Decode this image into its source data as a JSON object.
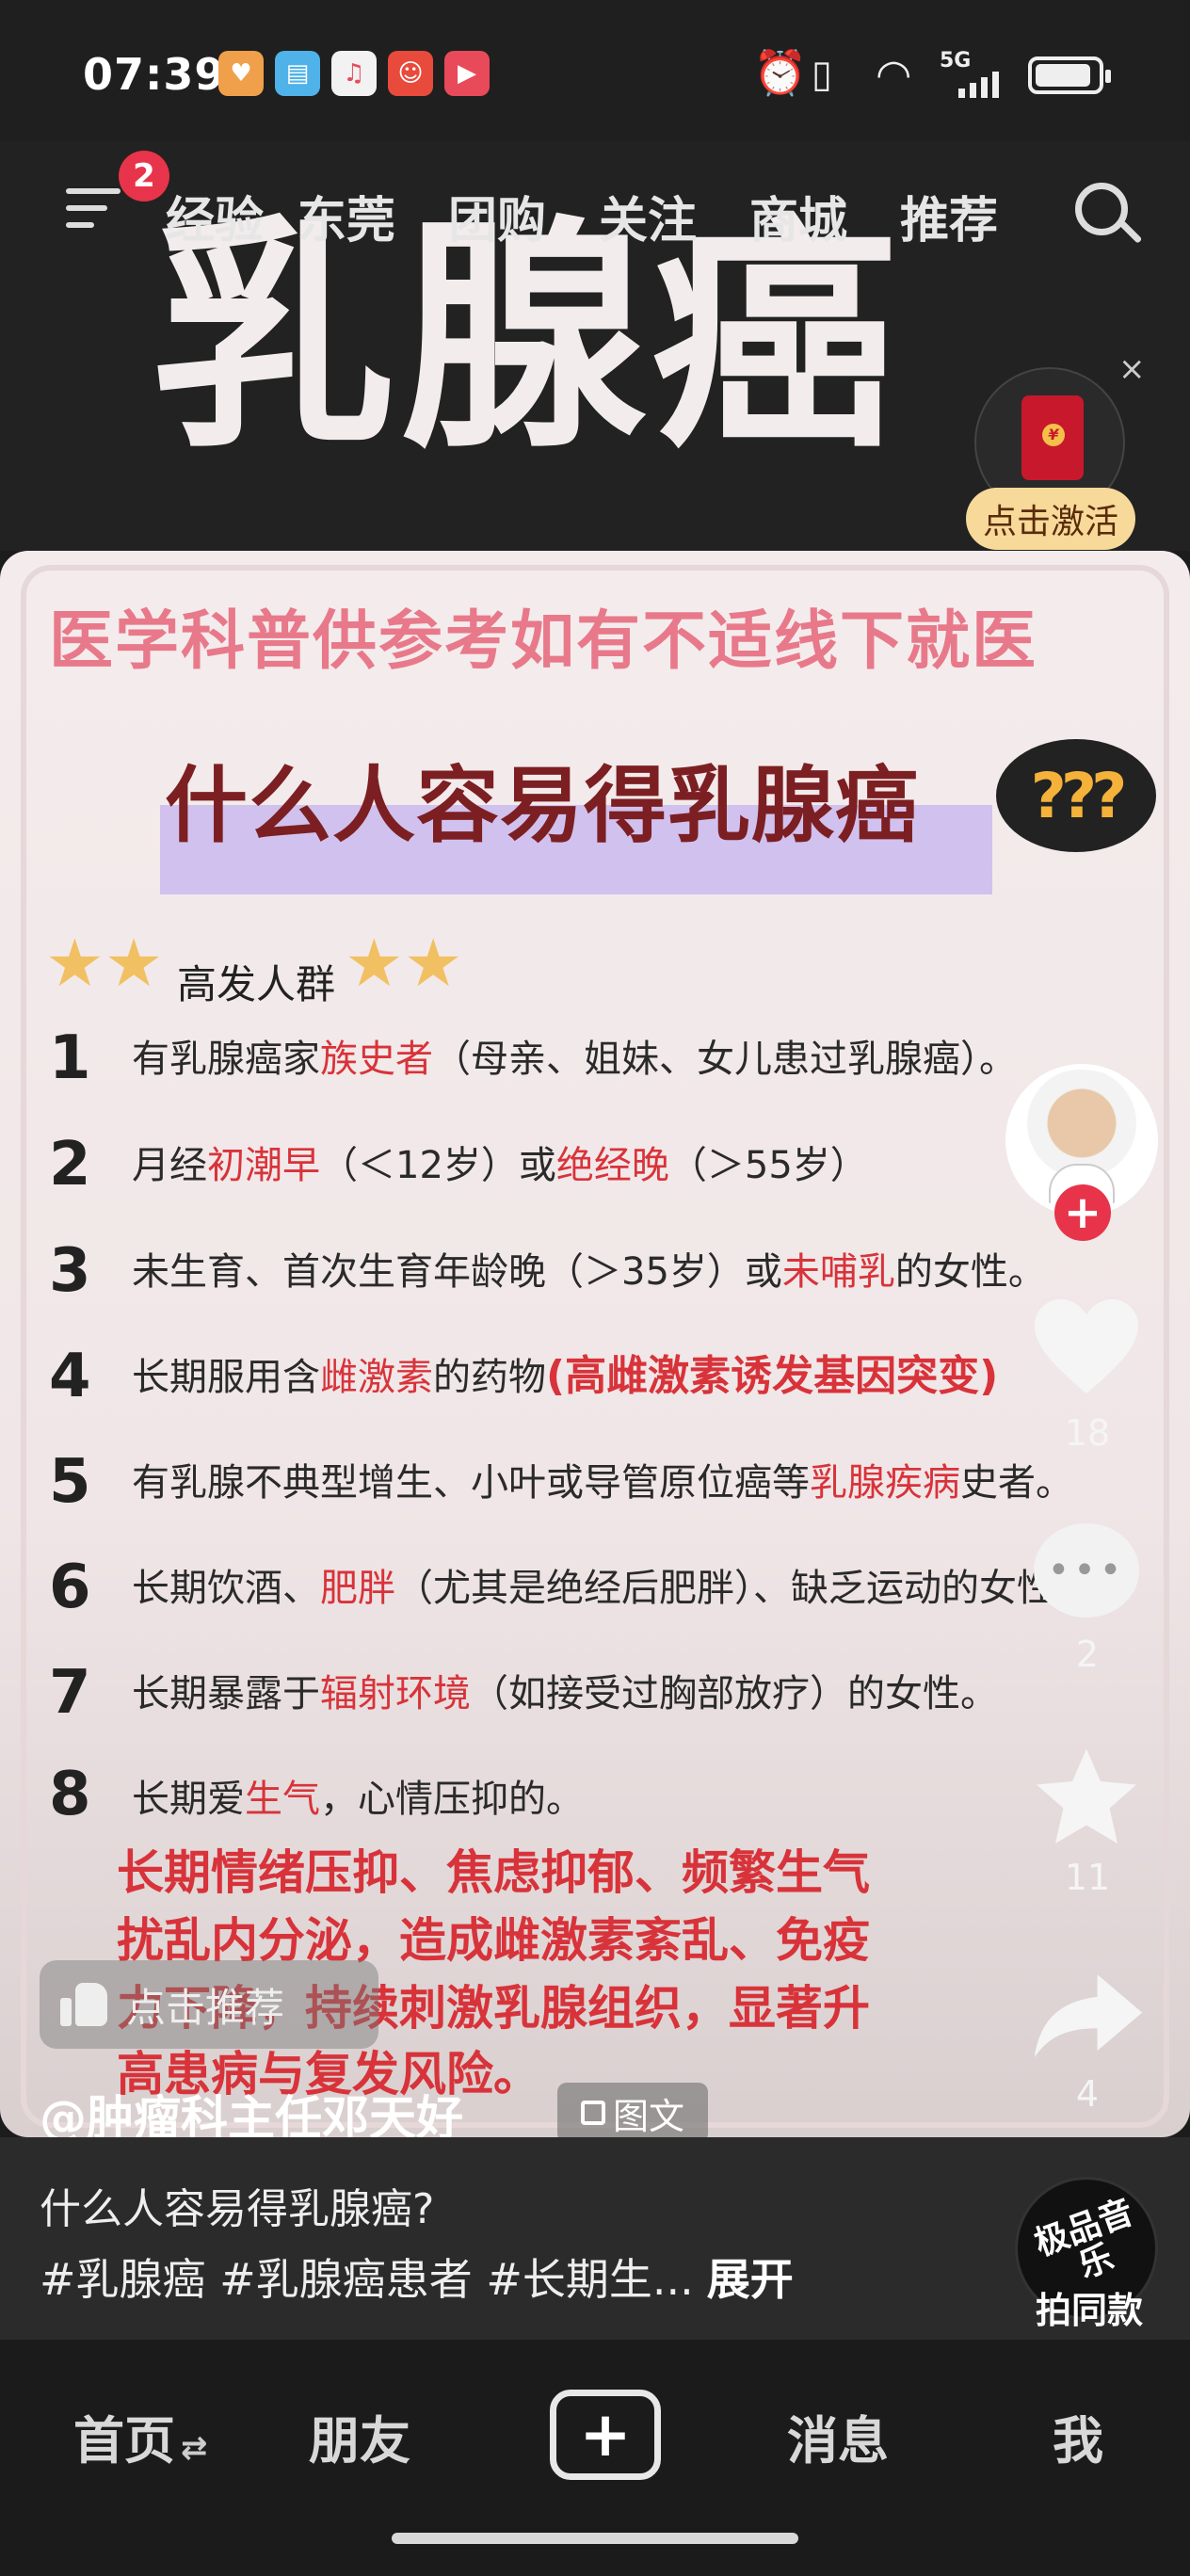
{
  "status_bar": {
    "time": "07:39",
    "app_icons": [
      {
        "name": "heart-app-icon",
        "color": "#f0a04b",
        "glyph": "♥"
      },
      {
        "name": "book-app-icon",
        "color": "#4fb2e8",
        "glyph": "▤"
      },
      {
        "name": "music-app-icon",
        "color": "#e8e8e8",
        "glyph": "♫"
      },
      {
        "name": "mascot-app-icon",
        "color": "#e84a3c",
        "glyph": "☺"
      },
      {
        "name": "video-app-icon",
        "color": "#e84a5a",
        "glyph": "▶"
      }
    ],
    "network": "5G"
  },
  "top_nav": {
    "notification_count": "2",
    "tabs": [
      "经验",
      "东莞",
      "团购",
      "关注",
      "商城",
      "推荐"
    ]
  },
  "cover": {
    "big_title": "乳腺癌",
    "red_packet_button": "点击激活",
    "close": "×"
  },
  "post": {
    "notice": "医学科普供参考如有不适线下就医",
    "heading": "什么人容易得乳腺癌",
    "question_icon": "???",
    "subhead": "高发人群",
    "items": [
      {
        "n": "1",
        "a": "有乳腺癌家",
        "r": "族史者",
        "b": "（母亲、姐妹、女儿患过乳腺癌）。"
      },
      {
        "n": "2",
        "a": "月经",
        "r": "初潮早",
        "b": "（＜12岁）或",
        "r2": "绝经晚",
        "c": "（＞55岁）"
      },
      {
        "n": "3",
        "a": "未生育、首次生育年龄晚（＞35岁）或",
        "r": "未哺乳",
        "b": "的女性。"
      },
      {
        "n": "4",
        "a": "长期服用含",
        "r": "雌激素",
        "b": "的药物",
        "extra": "(高雌激素诱发基因突变)"
      },
      {
        "n": "5",
        "a": "有乳腺不典型增生、小叶或导管原位癌等",
        "r": "乳腺疾病",
        "b": "史者。"
      },
      {
        "n": "6",
        "a": "长期饮酒、",
        "r": "肥胖",
        "b": "（尤其是绝经后肥胖）、缺乏运动的女性。"
      },
      {
        "n": "7",
        "a": "长期暴露于",
        "r": "辐射环境",
        "b": "（如接受过胸部放疗）的女性。"
      },
      {
        "n": "8",
        "a": "长期爱",
        "r": "生气",
        "b": "，心情压抑的。"
      }
    ],
    "callout_lines": [
      "长期情绪压抑、焦虑抑郁、频繁生气",
      "扰乱内分泌，造成雌激素紊乱、免疫",
      "力下降，持续刺激乳腺组织，显著升",
      "高患病与复发风险。"
    ],
    "like_pill": "点击推荐"
  },
  "actions": {
    "follow": "+",
    "likes": "18",
    "comments": "2",
    "favorites": "11",
    "shares": "4"
  },
  "caption": {
    "author": "@肿瘤科主任邓天好",
    "type_badge": "图文",
    "title": "什么人容易得乳腺癌?",
    "tags": "#乳腺癌 #乳腺癌患者 #长期生...",
    "expand": "展开",
    "music_label_top": "极品音乐",
    "music_label_bottom": "拍同款"
  },
  "bottom_nav": {
    "home": "首页",
    "home_arrow": "⇄",
    "friends": "朋友",
    "add": "+",
    "messages": "消息",
    "me": "我"
  },
  "colors": {
    "accent_red": "#d8333a",
    "heading": "#7c1f22",
    "notice_pink": "#e8798a",
    "badge_red": "#e8344a"
  }
}
